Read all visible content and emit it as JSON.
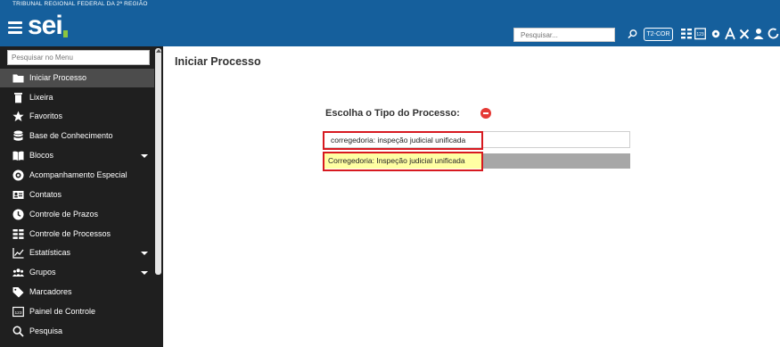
{
  "header": {
    "org_name": "TRIBUNAL REGIONAL FEDERAL DA 2ª REGIÃO",
    "logo_text": "sei",
    "search_placeholder": "Pesquisar...",
    "org_badge": "T2-COR",
    "colors": {
      "bar": "#155f9c",
      "logo_dot": "#8cc63f"
    }
  },
  "sidebar": {
    "search_placeholder": "Pesquisar no Menu",
    "items": [
      {
        "label": "Iniciar Processo",
        "icon": "folder-icon",
        "active": true
      },
      {
        "label": "Lixeira",
        "icon": "trash-icon"
      },
      {
        "label": "Favoritos",
        "icon": "star-icon"
      },
      {
        "label": "Base de Conhecimento",
        "icon": "database-icon"
      },
      {
        "label": "Blocos",
        "icon": "book-open-icon",
        "expandable": true
      },
      {
        "label": "Acompanhamento Especial",
        "icon": "eye-icon"
      },
      {
        "label": "Contatos",
        "icon": "contact-card-icon"
      },
      {
        "label": "Controle de Prazos",
        "icon": "clock-icon"
      },
      {
        "label": "Controle de Processos",
        "icon": "process-list-icon"
      },
      {
        "label": "Estatísticas",
        "icon": "chart-line-icon",
        "expandable": true
      },
      {
        "label": "Grupos",
        "icon": "users-icon",
        "expandable": true
      },
      {
        "label": "Marcadores",
        "icon": "tag-icon"
      },
      {
        "label": "Painel de Controle",
        "icon": "panel-123-icon"
      },
      {
        "label": "Pesquisa",
        "icon": "search-icon"
      }
    ]
  },
  "main": {
    "title": "Iniciar Processo",
    "choose_label": "Escolha o Tipo do Processo:",
    "type_input_value": "corregedoria: inspeção judicial unificada",
    "suggestion": "Corregedoria: Inspeção judicial unificada",
    "colors": {
      "highlight_box": "#d71920",
      "suggestion_bg": "#ffffa3",
      "suggest_bar": "#a7a7a7"
    }
  }
}
